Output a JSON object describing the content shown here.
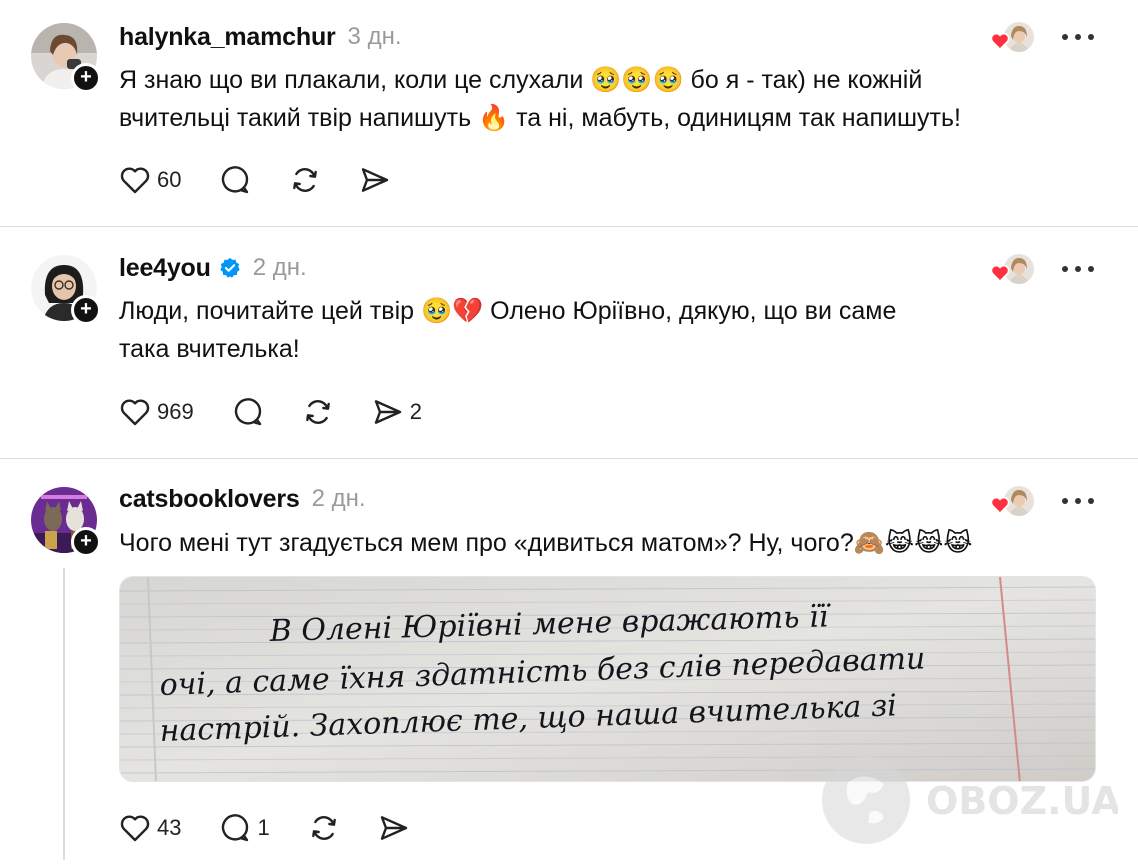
{
  "posts": [
    {
      "username": "halynka_mamchur",
      "time": "3 дн.",
      "text_line1": "Я знаю що ви плакали, коли це слухали 🥹🥹🥹 бо я - так) не кожній",
      "text_line2": "вчительці такий твір напишуть 🔥 та ні, мабуть, одиницям так напишуть!",
      "likes": "60",
      "replies": "",
      "reposts": "",
      "shares": ""
    },
    {
      "username": "lee4you",
      "verified": true,
      "time": "2 дн.",
      "text_line1": "Люди, почитайте цей твір 🥹💔 Олено Юріївно, дякую, що ви саме",
      "text_line2": "така вчителька!",
      "likes": "969",
      "replies": "",
      "reposts": "",
      "shares": "2"
    },
    {
      "username": "catsbooklovers",
      "time": "2 дн.",
      "text_line1": "Чого мені тут згадується мем про «дивиться матом»? Ну, чого?🙈😹😹😹",
      "likes": "43",
      "replies": "1",
      "reposts": "",
      "shares": ""
    }
  ],
  "media": {
    "handwriting_line1": "В Олені Юріївні мене вражають її",
    "handwriting_line2": "очі, а саме їхня здатність без слів передавати",
    "handwriting_line3": "настрій. Захоплює те, що наша вчителька зі"
  },
  "watermark": "OBOZ.UA",
  "colors": {
    "heart_red": "#ff3040",
    "verified_blue": "#0095f6",
    "text": "#101010",
    "muted": "#9a9a9a",
    "divider": "#dcdcdc"
  },
  "icons": [
    "plus-icon",
    "heart-icon",
    "comment-icon",
    "repost-icon",
    "share-icon",
    "more-icon",
    "verified-icon"
  ]
}
